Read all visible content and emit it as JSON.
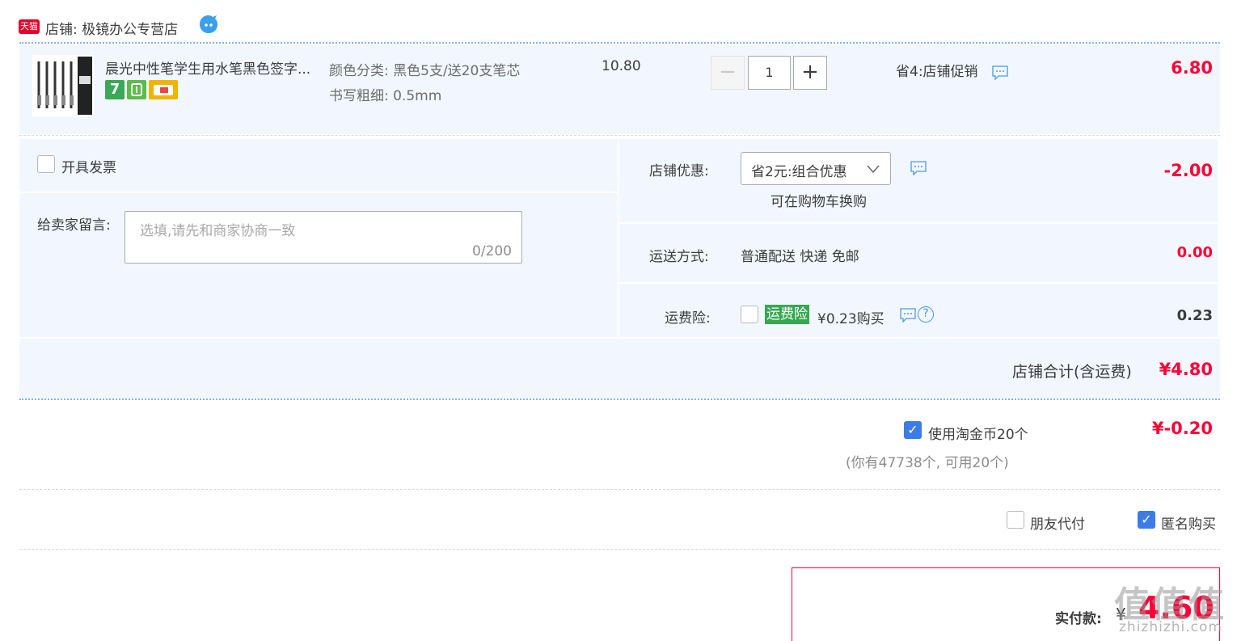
{
  "shop": {
    "platform_badge": "天猫",
    "name": "店铺: 极镜办公专营店",
    "ww_icon": "wangwang-chat-icon"
  },
  "item": {
    "title": "晨光中性笔学生用水笔黑色签字...",
    "sku_color_label": "颜色分类:",
    "sku_color_value": "黑色5支/送20支笔芯",
    "sku_width_label": "书写粗细:",
    "sku_width_value": "0.5mm",
    "badge_seven": "7",
    "unit_price": "10.80",
    "qty_minus": "−",
    "quantity": "1",
    "qty_plus": "+",
    "promo": "省4:店铺促销",
    "total": "6.80"
  },
  "services": {
    "invoice_label": "开具发票",
    "message_label": "给卖家留言:",
    "message_placeholder": "选填,请先和商家协商一致",
    "message_count": "0/200",
    "shop_discount_label": "店铺优惠:",
    "shop_discount_selected": "省2元:组合优惠",
    "shop_discount_note": "可在购物车换购",
    "shop_discount_amount": "-2.00",
    "shipping_label": "运送方式:",
    "shipping_value": "普通配送 快递 免邮",
    "shipping_amount": "0.00",
    "insurance_label": "运费险:",
    "insurance_badge": "运费险",
    "insurance_price": "¥0.23购买",
    "insurance_amount": "0.23",
    "help_glyph": "?"
  },
  "shop_total": {
    "label": "店铺合计(含运费)",
    "amount": "¥4.80"
  },
  "coins": {
    "label": "使用淘金币20个",
    "amount": "¥-0.20",
    "note": "(你有47738个, 可用20个)",
    "checked": true
  },
  "options": {
    "friend_pay": "朋友代付",
    "anonymous": "匿名购买"
  },
  "final": {
    "label": "实付款:",
    "currency": "¥",
    "amount": "4.60"
  },
  "watermark": {
    "main": "值值值",
    "sub": "zhizhizhi.com"
  },
  "colors": {
    "accent_red": "#ff0036",
    "panel_bg": "#f2f7ff",
    "checkbox_blue": "#3d7ce8",
    "insurance_green": "#36a84f"
  }
}
